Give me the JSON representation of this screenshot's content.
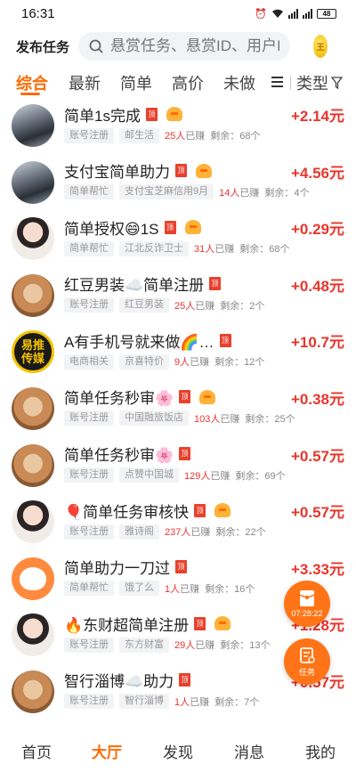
{
  "status_bar": {
    "time": "16:31",
    "battery": "48"
  },
  "header": {
    "publish_label": "发布任务",
    "search_placeholder": "悬赏任务、悬赏ID、用户ID",
    "coin_label": "王"
  },
  "tabs": [
    {
      "label": "综合",
      "active": true
    },
    {
      "label": "最新",
      "active": false
    },
    {
      "label": "简单",
      "active": false
    },
    {
      "label": "高价",
      "active": false
    },
    {
      "label": "未做",
      "active": false
    }
  ],
  "type_filter_label": "类型",
  "pin_badge": "顶",
  "logo_avatar": {
    "line1": "易推",
    "line2": "传媒"
  },
  "tasks": [
    {
      "title": "简单1s完成",
      "avatar": "car",
      "bao": true,
      "tag1": "账号注册",
      "tag2": "邮生活",
      "earned_count": "25人",
      "earned_suffix": "已赚",
      "remaining": "剩余：68个",
      "price": "+2.14元"
    },
    {
      "title": "支付宝简单助力",
      "avatar": "car",
      "bao": true,
      "tag1": "简单帮忙",
      "tag2": "支付宝芝麻信用9月",
      "earned_count": "14人",
      "earned_suffix": "已赚",
      "remaining": "剩余：4个",
      "price": "+4.56元"
    },
    {
      "title": "简单授权😄1S",
      "avatar": "girl",
      "bao": true,
      "tag1": "简单帮忙",
      "tag2": "江北反诈卫士",
      "earned_count": "31人",
      "earned_suffix": "已赚",
      "remaining": "剩余：68个",
      "price": "+0.29元"
    },
    {
      "title": "红豆男装☁️简单注册",
      "avatar": "cat",
      "bao": false,
      "tag1": "账号注册",
      "tag2": "红豆男装",
      "earned_count": "25人",
      "earned_suffix": "已赚",
      "remaining": "剩余：2个",
      "price": "+0.48元"
    },
    {
      "title": "A有手机号就来做🌈…",
      "avatar": "logo",
      "bao": false,
      "tag1": "电商相关",
      "tag2": "京喜特价",
      "earned_count": "9人",
      "earned_suffix": "已赚",
      "remaining": "剩余：12个",
      "price": "+10.7元"
    },
    {
      "title": "简单任务秒审🌸",
      "avatar": "cat",
      "bao": true,
      "tag1": "账号注册",
      "tag2": "中国融旅饭店",
      "earned_count": "103人",
      "earned_suffix": "已赚",
      "remaining": "剩余：25个",
      "price": "+0.38元"
    },
    {
      "title": "简单任务秒审🌸",
      "avatar": "cat",
      "bao": false,
      "tag1": "账号注册",
      "tag2": "点赞中国城",
      "earned_count": "129人",
      "earned_suffix": "已赚",
      "remaining": "剩余：69个",
      "price": "+0.57元"
    },
    {
      "title": "🎈简单任务审核快",
      "avatar": "girl",
      "bao": true,
      "tag1": "账号注册",
      "tag2": "雅诗阁",
      "earned_count": "237人",
      "earned_suffix": "已赚",
      "remaining": "剩余：22个",
      "price": "+0.57元"
    },
    {
      "title": "简单助力一刀过",
      "avatar": "cartoon",
      "bao": false,
      "tag1": "简单帮忙",
      "tag2": "饿了么",
      "earned_count": "1人",
      "earned_suffix": "已赚",
      "remaining": "剩余：16个",
      "price": "+3.33元"
    },
    {
      "title": "🔥东财超简单注册",
      "avatar": "girl",
      "bao": true,
      "tag1": "账号注册",
      "tag2": "东方财富",
      "earned_count": "29人",
      "earned_suffix": "已赚",
      "remaining": "剩余：13个",
      "price": "+1.28元"
    },
    {
      "title": "智行淄博☁️助力",
      "avatar": "cat",
      "bao": false,
      "tag1": "账号注册",
      "tag2": "智行淄博",
      "earned_count": "1人",
      "earned_suffix": "已赚",
      "remaining": "剩余：7个",
      "price": "+0.57元"
    }
  ],
  "float_timer": {
    "time": "07:28:22"
  },
  "float_task": {
    "label": "任务"
  },
  "bottom_nav": [
    {
      "label": "首页",
      "active": false
    },
    {
      "label": "大厅",
      "active": true
    },
    {
      "label": "发现",
      "active": false
    },
    {
      "label": "消息",
      "active": false
    },
    {
      "label": "我的",
      "active": false
    }
  ],
  "colors": {
    "accent": "#ff6a00",
    "price_red": "#e8352b",
    "pin_red": "#e8412c"
  }
}
